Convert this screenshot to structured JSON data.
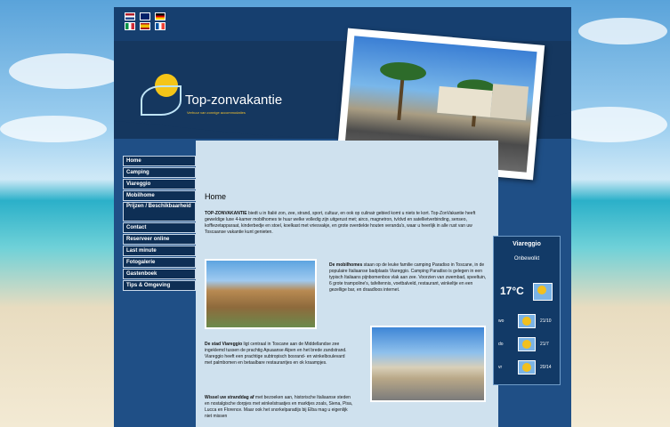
{
  "flags": [
    {
      "name": "nl",
      "stripes": [
        "#ae1c28",
        "#ffffff",
        "#21468b"
      ]
    },
    {
      "name": "uk",
      "stripes": [
        "#012169",
        "#ffffff",
        "#c8102e"
      ]
    },
    {
      "name": "de",
      "stripes": [
        "#000000",
        "#dd0000",
        "#ffce00"
      ]
    },
    {
      "name": "it",
      "stripes": [
        "#009246",
        "#ffffff",
        "#ce2b37"
      ]
    },
    {
      "name": "es",
      "stripes": [
        "#aa151b",
        "#f1bf00",
        "#aa151b"
      ]
    },
    {
      "name": "fr",
      "stripes": [
        "#0055a4",
        "#ffffff",
        "#ef4135"
      ]
    }
  ],
  "logo": {
    "title": "Top-zonvakantie",
    "subtitle": "Verhuur van zonnige accommodaties"
  },
  "nav": [
    "Home",
    "Camping",
    "Viareggio",
    "Mobilhome",
    "Prijzen / Beschikbaarheid",
    "Contact",
    "Reserveer online",
    "Last minute",
    "Fotogalerie",
    "Gastenboek",
    "Tips & Omgeving"
  ],
  "content": {
    "heading": "Home",
    "p1_bold": "TOP-ZONVAKANTIE",
    "p1": " biedt u in Italië zon, zee, strand, sport, cultuur, en ook op culinair gebied komt u niets te kort. Top-ZonVakantie heeft geweldige luxe 4-kamer mobilhomes te huur welke volledig zijn uitgerust met; airco, magnetron, tv/dvd en satellietverbinding, senseo, koffiezetapparaat, kinderbedje en stoel, koelkast met vriesvakje, en grote overdekte houten veranda's, waar u heerlijk in alle rust van uw Toscaanse vakantie kunt genieten.",
    "p2_bold": "De mobilhomes",
    "p2": " staan op de leuke familie camping Paradiso in Toscane, in de populaire Italiaanse badplaats Viareggio. Camping Paradiso is gelegen in een typisch Italiaans pijnbomenbos vlak aan zee. Voorzien van zwembad, speeltuin, 6 grote trampoline's, tafeltennis, voetbalveld, restaurant, winkeltje en een gezellige bar, en draadloos internet.",
    "p3_bold": "De stad Viareggio",
    "p3": " ligt centraal in Toscane aan de Middellandse zee ingeklemd tussen de prachtig Apuaanse Alpen en het brede zandstrand. Viareggio heeft een prachtige subtropisch bosrand- en winkelboulevard met palmbomen en betaalbare restaurantjes en ok kraampjes.",
    "p4_bold": "Wissel uw stranddag af",
    "p4": " met bezoeken aan, historische Italiaanse steden en nostalgische dorpjes met winkelstraatjes en marktjes zoals, Siena, Pisa, Lucca en Florence. Maar ook het snorkelparadijs bij Elba mag u eigenlijk niet missen"
  },
  "weather": {
    "city": "Viareggio",
    "condition": "Onbewolkt",
    "temp": "17°C",
    "forecast": [
      {
        "day": "wo",
        "date": "21/10"
      },
      {
        "day": "do",
        "date": "21/7"
      },
      {
        "day": "vr",
        "date": "20/14"
      }
    ]
  }
}
